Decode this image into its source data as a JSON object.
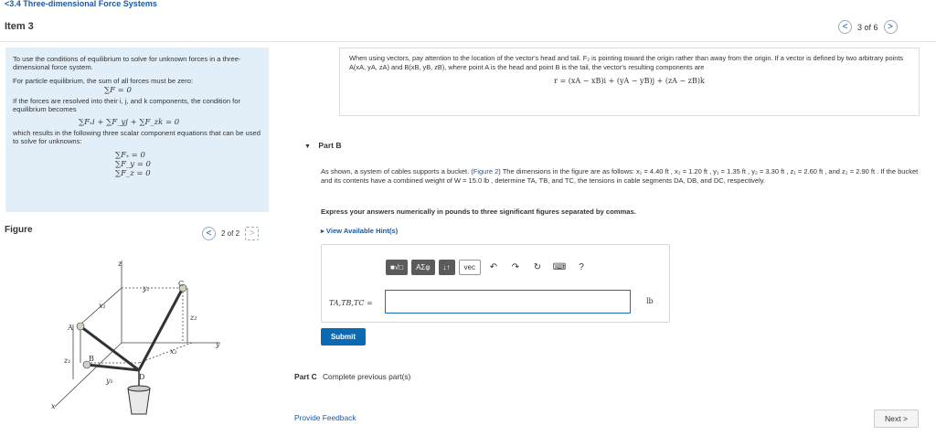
{
  "nav": {
    "back_label": "3.4 Three-dimensional Force Systems"
  },
  "item": {
    "title": "Item 3",
    "pager": "3 of 6"
  },
  "intro": {
    "p1": "To use the conditions of equilibrium to solve for unknown forces in a three-dimensional force system.",
    "p2": "For particle equilibrium, the sum of all forces must be zero:",
    "eq1": "∑F = 0",
    "p3": "If the forces are resolved into their i, j, and k components, the condition for equilibrium becomes",
    "eq2": "∑Fₓi + ∑F_yj + ∑F_zk = 0",
    "p4": "which results in the following three scalar component equations that can be used to solve for unknowns:",
    "eq3a": "∑Fₓ = 0",
    "eq3b": "∑F_y = 0",
    "eq3c": "∑F_z = 0"
  },
  "figure": {
    "label": "Figure",
    "pager": "2 of 2",
    "labels": {
      "z": "z",
      "y2": "y₂",
      "c": "C",
      "x1": "x₁",
      "z2": "z₂",
      "a": "A",
      "y": "y",
      "z1": "z₁",
      "b": "B",
      "x2": "x₂",
      "d": "D",
      "y1": "y₁",
      "x": "x"
    }
  },
  "hint": {
    "text": "When using vectors, pay attention to the location of the vector's head and tail. F₂ is pointing toward the origin rather than away from the origin. If a vector is defined by two arbitrary points A(xA, yA, zA) and B(xB, yB, zB), where point A is the head and point B is the tail, the vector's resulting components are",
    "formula": "r = (xA − xB)i + (yA − yB)j + (zA − zB)k"
  },
  "partB": {
    "title": "Part B",
    "problem_pre": "As shown, a system of cables supports a bucket. (",
    "figure_link": "Figure 2",
    "problem_post": ") The dimensions in the figure are as follows: x₁ = 4.40 ft , x₂ = 1.20 ft , y₁ = 1.35 ft , y₂ = 3.30 ft , z₁ = 2.60 ft , and z₂ = 2.90 ft . If the bucket and its contents have a combined weight of W = 15.0 lb , determine TA, TB, and TC, the tensions in cable segments DA, DB, and DC, respectively.",
    "express": "Express your answers numerically in pounds to three significant figures separated by commas.",
    "hints_link": "View Available Hint(s)",
    "toolbar": {
      "template": "■√□",
      "greek": "ΑΣφ",
      "arrows": "↓↑",
      "vec": "vec",
      "undo": "↶",
      "redo": "↷",
      "reset": "↻",
      "keyboard": "⌨",
      "help": "?"
    },
    "answer_label": "TA,TB,TC =",
    "answer_value": "",
    "unit": "lb",
    "submit": "Submit"
  },
  "partC": {
    "title": "Part C",
    "text": "Complete previous part(s)"
  },
  "footer": {
    "feedback": "Provide Feedback",
    "next": "Next"
  }
}
